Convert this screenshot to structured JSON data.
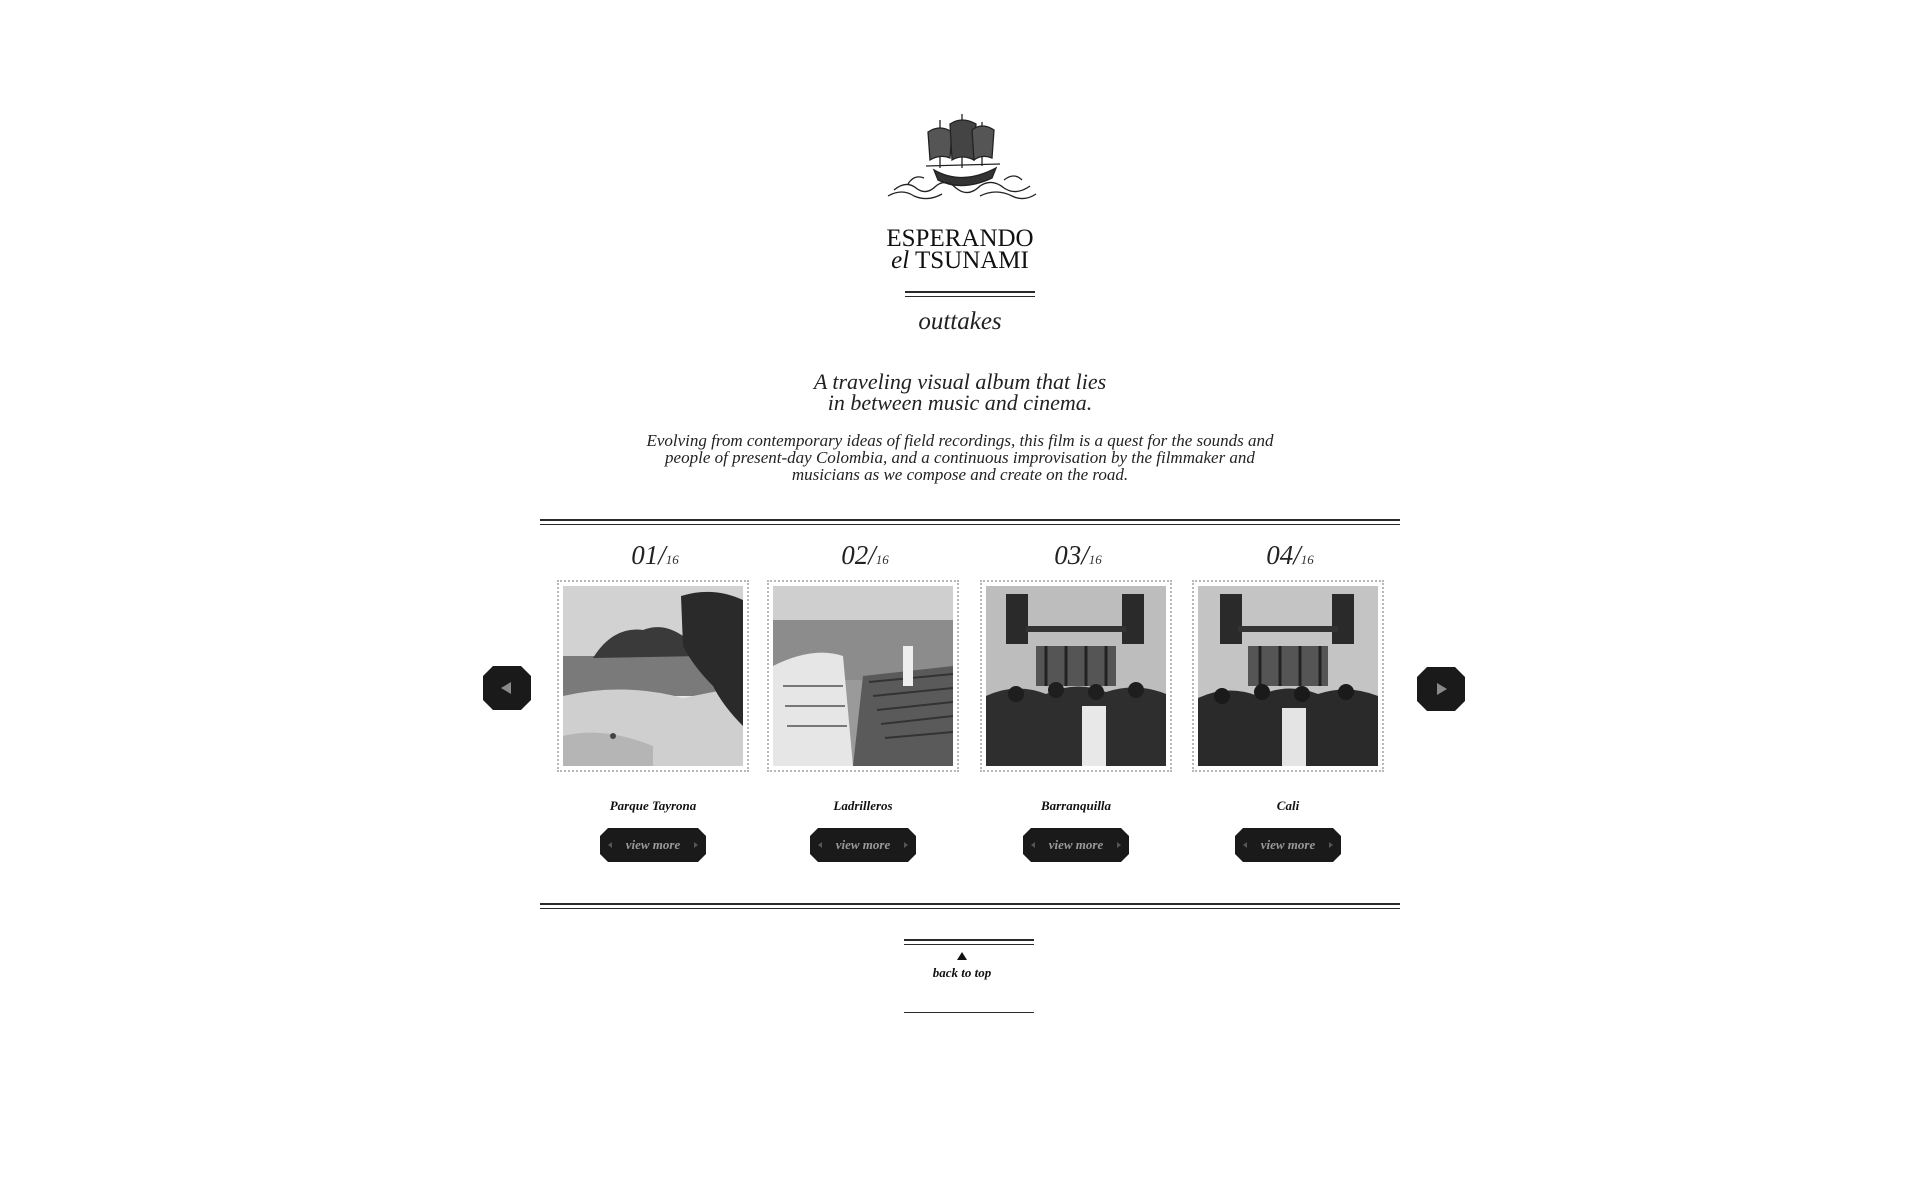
{
  "brand": {
    "title_line1": "ESPERANDO",
    "title_el": "el",
    "title_line2": "TSUNAMI",
    "subtitle": "outtakes",
    "logo_icon": "ship-engraving-icon"
  },
  "intro": {
    "tagline_line1": "A traveling visual album that lies",
    "tagline_line2": "in between music and cinema.",
    "description_line1": "Evolving from contemporary ideas of field recordings, this film is a quest for the sounds and",
    "description_line2": "people of present-day Colombia, and a continuous improvisation by the filmmaker and",
    "description_line3": "musicians as we compose and create on the road."
  },
  "carousel": {
    "prev_icon": "arrow-left-icon",
    "next_icon": "arrow-right-icon",
    "total": "16",
    "items": [
      {
        "number": "01/",
        "total": "16",
        "place": "Parque Tayrona",
        "button": "view more"
      },
      {
        "number": "02/",
        "total": "16",
        "place": "Ladrilleros",
        "button": "view more"
      },
      {
        "number": "03/",
        "total": "16",
        "place": "Barranquilla",
        "button": "view more"
      },
      {
        "number": "04/",
        "total": "16",
        "place": "Cali",
        "button": "view more"
      }
    ]
  },
  "footer": {
    "back_to_top": "back to top",
    "back_icon": "triangle-up-icon"
  },
  "colors": {
    "ink": "#1a1a1a",
    "button_bg": "#1a1a1a",
    "button_text": "#9a9a9a",
    "frame_border": "#b8b8b8"
  }
}
